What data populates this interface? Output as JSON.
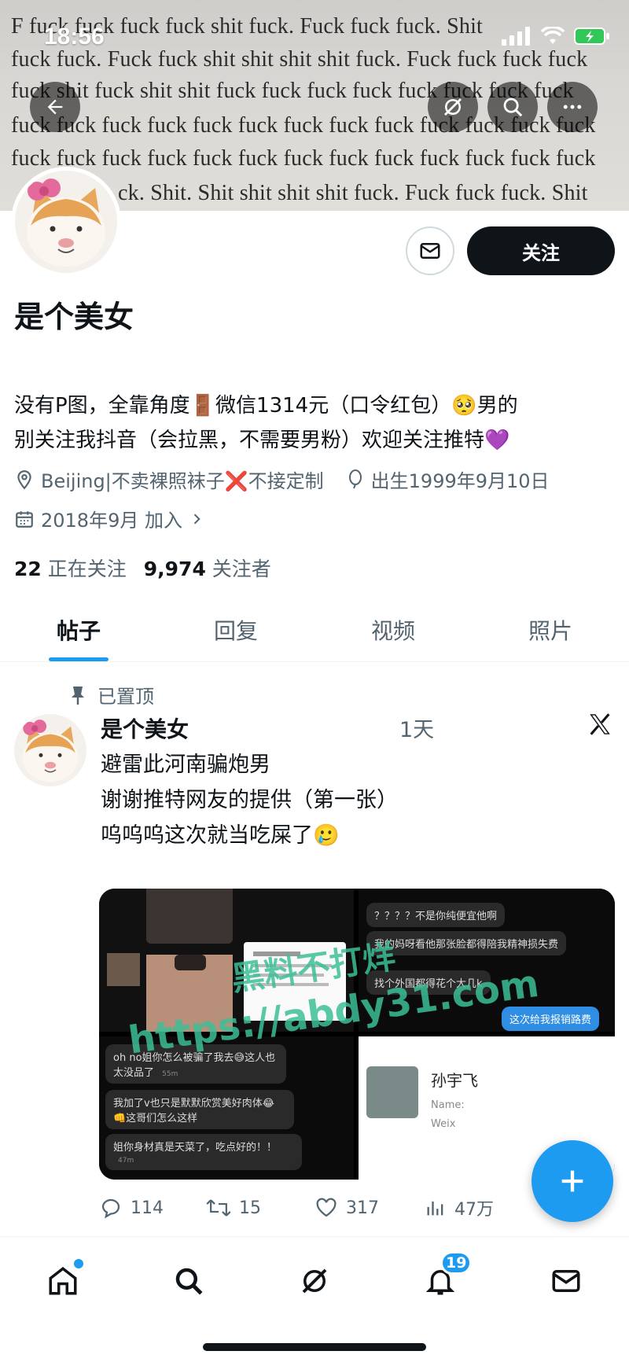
{
  "status_bar": {
    "time": "18:56"
  },
  "banner": {
    "lines": [
      "F  fuck fuck fuck fuck shit fuck. Fuck fuck fuck. Shit",
      "fuck fuck. Fuck fuck shit shit shit shit fuck. Fuck fuck fuck fuck",
      "fuck shit fuck shit shit fuck fuck fuck fuck fuck fuck fuck fuck",
      "fuck fuck fuck fuck fuck fuck fuck fuck fuck fuck fuck fuck fuck",
      "fuck fuck fuck fuck fuck fuck fuck fuck fuck fuck fuck fuck fuck",
      "ck. Shit. Shit shit shit shit fuck. Fuck fuck fuck. Shit"
    ]
  },
  "profile": {
    "follow_label": "关注",
    "name": "是个美女",
    "bio_line1": "没有P图，全靠角度🚪微信1314元（口令红包）🥺男的",
    "bio_line2": "别关注我抖音（会拉黑，不需要男粉）欢迎关注推特💜",
    "location": "Beijing|不卖裸照袜子❌不接定制",
    "birthday": "出生1999年9月10日",
    "joined": "2018年9月 加入",
    "following_count": "22",
    "following_label": "正在关注",
    "followers_count": "9,974",
    "followers_label": "关注者"
  },
  "tabs": [
    {
      "label": "帖子",
      "active": true
    },
    {
      "label": "回复",
      "active": false
    },
    {
      "label": "视频",
      "active": false
    },
    {
      "label": "照片",
      "active": false
    }
  ],
  "post": {
    "pinned_label": "已置顶",
    "author": "是个美女",
    "time": "1天",
    "text_lines": [
      "避雷此河南骗炮男",
      "谢谢推特网友的提供（第一张）",
      "呜呜呜这次就当吃屎了🥲"
    ],
    "media_texts": {
      "q1": "？？？？不是你纯便宜他啊",
      "q2": "我的妈呀看他那张脸都得陪我精神损失费",
      "q3": "找个外国都得花个大几k",
      "q4": "这次给我报销路费",
      "c1": "oh no姐你怎么被骗了我去😅这人也太没品了",
      "c1_time": "55m",
      "c2": "我加了v也只是默默欣赏美好肉体😂👊这哥们怎么这样",
      "c3": "姐你身材真是天菜了，吃点好的！！",
      "c3_time": "47m",
      "contact_name": "孙宇飞",
      "contact_line1": "Name:",
      "contact_line2": "Weix"
    },
    "watermark_line1": "黑料不打烊",
    "watermark_line2": "https://abdy31.com",
    "replies": "114",
    "reposts": "15",
    "likes": "317",
    "views": "47万"
  },
  "nav": {
    "notifications_badge": "19"
  },
  "colors": {
    "accent": "#1d9bf0",
    "text": "#0f1419",
    "muted": "#536471"
  }
}
